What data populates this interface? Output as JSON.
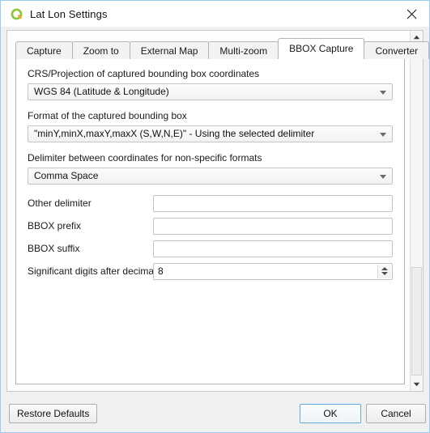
{
  "window": {
    "title": "Lat Lon Settings",
    "app_icon": "qgis-logo-icon",
    "close_icon": "close-icon",
    "accent_color": "#9ccded",
    "focus_color": "#5ea9e0"
  },
  "tabs": [
    {
      "label": "Capture",
      "active": false
    },
    {
      "label": "Zoom to",
      "active": false
    },
    {
      "label": "External Map",
      "active": false
    },
    {
      "label": "Multi-zoom",
      "active": false
    },
    {
      "label": "BBOX Capture",
      "active": true
    },
    {
      "label": "Converter",
      "active": false
    }
  ],
  "form": {
    "crs": {
      "label": "CRS/Projection of captured bounding box coordinates",
      "value": "WGS 84 (Latitude & Longitude)"
    },
    "format": {
      "label": "Format of the captured bounding box",
      "value": "\"minY,minX,maxY,maxX (S,W,N,E)\" - Using the selected delimiter"
    },
    "delimiter": {
      "label": "Delimiter between coordinates for non-specific formats",
      "value": "Comma Space"
    },
    "other_delimiter": {
      "label": "Other delimiter",
      "value": "",
      "placeholder": ""
    },
    "bbox_prefix": {
      "label": "BBOX prefix",
      "value": "",
      "placeholder": ""
    },
    "bbox_suffix": {
      "label": "BBOX suffix",
      "value": "",
      "placeholder": ""
    },
    "significant_digits": {
      "label": "Significant digits after decimal",
      "value": "8"
    }
  },
  "footer": {
    "restore_defaults": "Restore Defaults",
    "ok": "OK",
    "cancel": "Cancel"
  }
}
